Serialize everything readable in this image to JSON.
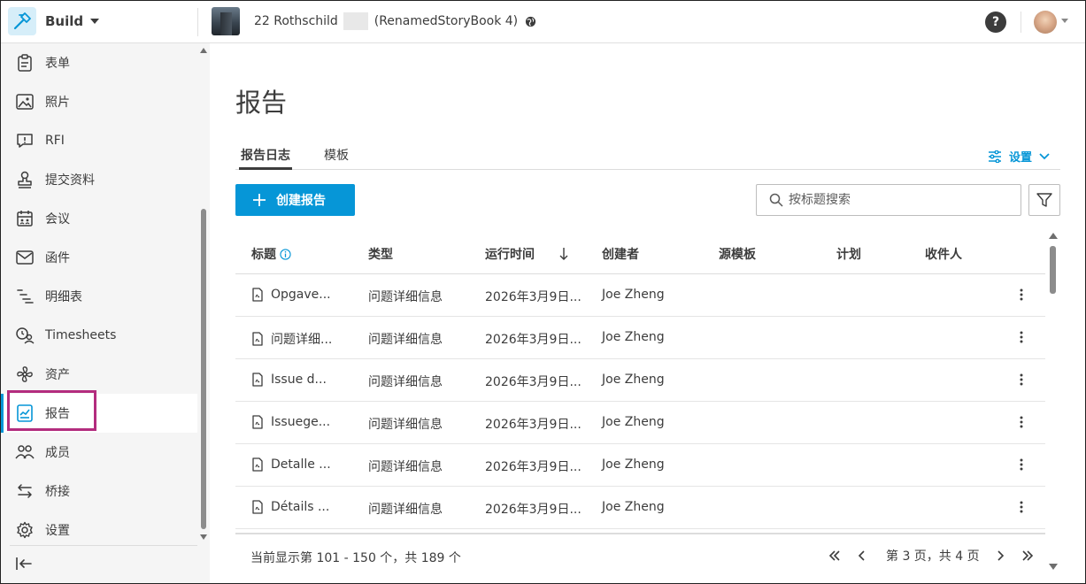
{
  "header": {
    "app_name": "Build",
    "project_name_prefix": "22 Rothschild",
    "project_name_suffix": "(RenamedStoryBook 4)",
    "help_label": "?"
  },
  "sidebar": {
    "items": [
      {
        "label": "表单",
        "icon": "form-icon"
      },
      {
        "label": "照片",
        "icon": "photo-icon"
      },
      {
        "label": "RFI",
        "icon": "rfi-icon"
      },
      {
        "label": "提交资料",
        "icon": "stamp-icon"
      },
      {
        "label": "会议",
        "icon": "calendar-icon"
      },
      {
        "label": "函件",
        "icon": "mail-icon"
      },
      {
        "label": "明细表",
        "icon": "schedule-icon"
      },
      {
        "label": "Timesheets",
        "icon": "timesheets-icon"
      },
      {
        "label": "资产",
        "icon": "assets-icon"
      },
      {
        "label": "报告",
        "icon": "report-icon",
        "active": true
      },
      {
        "label": "成员",
        "icon": "members-icon"
      },
      {
        "label": "桥接",
        "icon": "bridge-icon"
      },
      {
        "label": "设置",
        "icon": "gear-icon"
      }
    ]
  },
  "main": {
    "title": "报告",
    "tabs": [
      {
        "label": "报告日志",
        "active": true
      },
      {
        "label": "模板",
        "active": false
      }
    ],
    "settings_label": "设置",
    "create_button_label": "创建报告",
    "search_placeholder": "按标题搜索"
  },
  "table": {
    "columns": [
      "标题",
      "类型",
      "运行时间",
      "创建者",
      "源模板",
      "计划",
      "收件人"
    ],
    "rows": [
      {
        "title": "Opgave...",
        "type": "问题详细信息",
        "run_time": "2026年3月9日...",
        "creator": "Joe Zheng",
        "source_template": "",
        "schedule": "",
        "recipients": ""
      },
      {
        "title": "问题详细...",
        "type": "问题详细信息",
        "run_time": "2026年3月9日...",
        "creator": "Joe Zheng",
        "source_template": "",
        "schedule": "",
        "recipients": ""
      },
      {
        "title": "Issue d...",
        "type": "问题详细信息",
        "run_time": "2026年3月9日...",
        "creator": "Joe Zheng",
        "source_template": "",
        "schedule": "",
        "recipients": ""
      },
      {
        "title": "Issuege...",
        "type": "问题详细信息",
        "run_time": "2026年3月9日...",
        "creator": "Joe Zheng",
        "source_template": "",
        "schedule": "",
        "recipients": ""
      },
      {
        "title": "Detalle ...",
        "type": "问题详细信息",
        "run_time": "2026年3月9日...",
        "creator": "Joe Zheng",
        "source_template": "",
        "schedule": "",
        "recipients": ""
      },
      {
        "title": "Détails ...",
        "type": "问题详细信息",
        "run_time": "2026年3月9日...",
        "creator": "Joe Zheng",
        "source_template": "",
        "schedule": "",
        "recipients": ""
      }
    ]
  },
  "footer": {
    "status": "当前显示第 101 - 150 个，共 189 个",
    "page_info": "第 3 页，共 4 页"
  },
  "colors": {
    "accent": "#0696d7",
    "highlight_border": "#b32c7e",
    "sidebar_bg": "#f5f5f5",
    "text": "#3c3c3c"
  }
}
